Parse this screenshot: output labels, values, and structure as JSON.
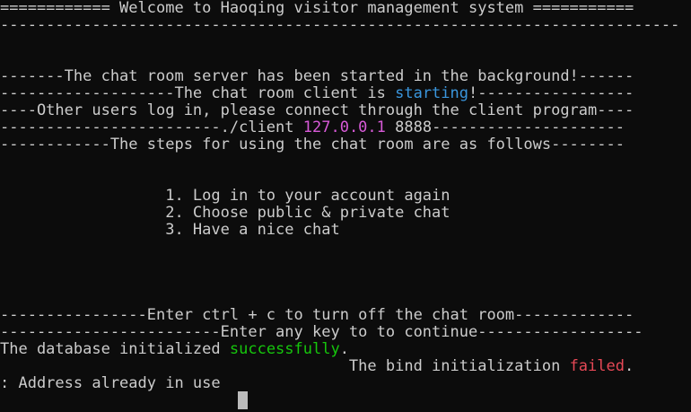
{
  "terminal": {
    "lines": [
      "============ Welcome to Haoqing visitor management system ===========",
      "--------------------------------------------------------------------------",
      "",
      "",
      "-------The chat room server has been started in the background!------",
      "-------------------The chat room client is ",
      "----Other users log in, please connect through the client program----",
      "------------------------./client ",
      "------------The steps for using the chat room are as follows--------",
      "",
      "",
      "                  1. Log in to your account again",
      "                  2. Choose public & private chat",
      "                  3. Have a nice chat",
      "",
      "",
      "",
      "",
      "----------------Enter ctrl + c to turn off the chat room-------------",
      "------------------------Enter any key to to continue------------------",
      "The database initialized ",
      "                                      The bind initialization ",
      ": Address already in use"
    ],
    "starting_word": "starting",
    "starting_suffix": "!-----------------",
    "ip_address": "127.0.0.1",
    "port_suffix": " 8888---------------------",
    "success_word": "successfully",
    "success_suffix": ".",
    "failed_word": "failed",
    "failed_suffix": ".",
    "colors": {
      "background": "#0c0c0c",
      "text": "#cccccc",
      "cyan": "#3a96dd",
      "magenta": "#d85ad8",
      "green": "#16c60c",
      "red": "#e74856"
    }
  }
}
